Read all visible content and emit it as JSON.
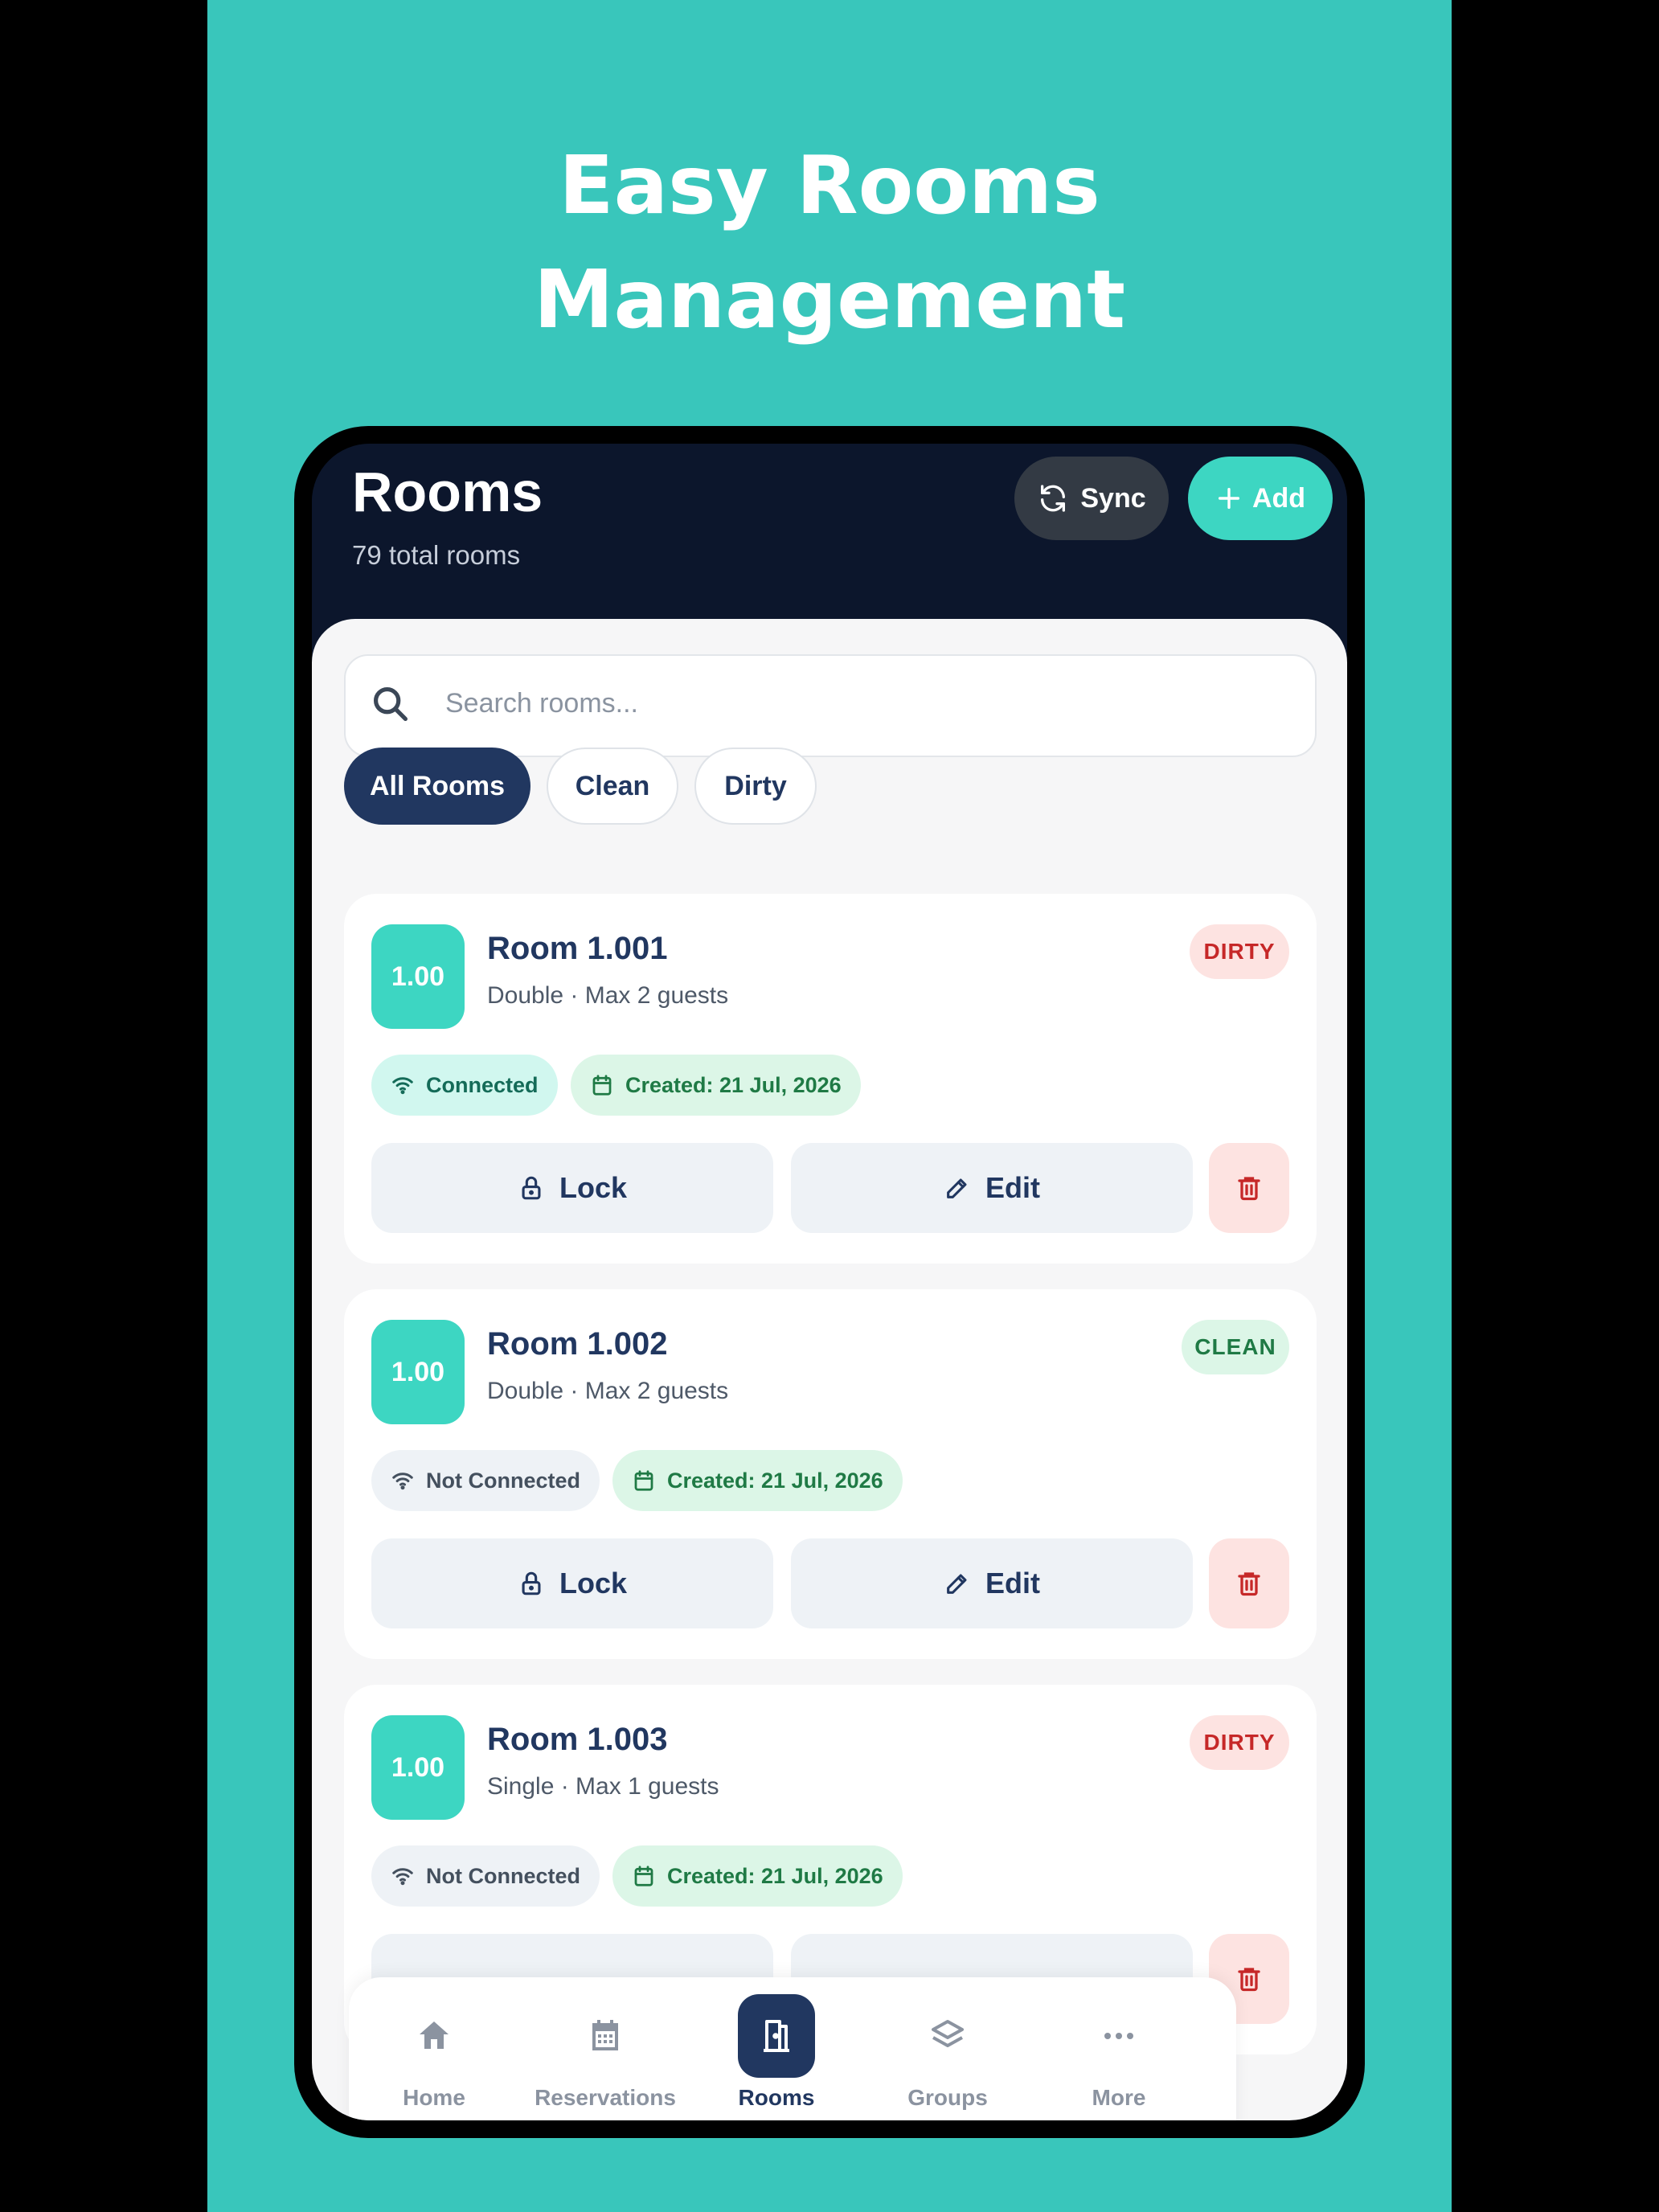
{
  "hero": {
    "line1": "Easy Rooms",
    "line2": "Management"
  },
  "header": {
    "title": "Rooms",
    "subtitle": "79 total rooms",
    "sync_label": "Sync",
    "add_label": "Add"
  },
  "search": {
    "placeholder": "Search rooms..."
  },
  "filters": [
    "All Rooms",
    "Clean",
    "Dirty"
  ],
  "rooms": [
    {
      "badge": "1.00",
      "name": "Room 1.001",
      "details": "Double · Max 2 guests",
      "status": "DIRTY",
      "connection": "Connected",
      "created": "Created: 21 Jul, 2026"
    },
    {
      "badge": "1.00",
      "name": "Room 1.002",
      "details": "Double · Max 2 guests",
      "status": "CLEAN",
      "connection": "Not Connected",
      "created": "Created: 21 Jul, 2026"
    },
    {
      "badge": "1.00",
      "name": "Room 1.003",
      "details": "Single · Max 1 guests",
      "status": "DIRTY",
      "connection": "Not Connected",
      "created": "Created: 21 Jul, 2026"
    }
  ],
  "actions": {
    "lock": "Lock",
    "edit": "Edit"
  },
  "nav": [
    {
      "label": "Home",
      "icon": "home-icon"
    },
    {
      "label": "Reservations",
      "icon": "calendar-icon"
    },
    {
      "label": "Rooms",
      "icon": "door-icon",
      "active": true
    },
    {
      "label": "Groups",
      "icon": "layers-icon"
    },
    {
      "label": "More",
      "icon": "more-icon"
    }
  ],
  "colors": {
    "poster_bg": "#39c6bb",
    "accent": "#3dd6c2",
    "navy": "#213760",
    "dark": "#0c162c",
    "dirty": "#c62828",
    "clean": "#1f7a45"
  }
}
